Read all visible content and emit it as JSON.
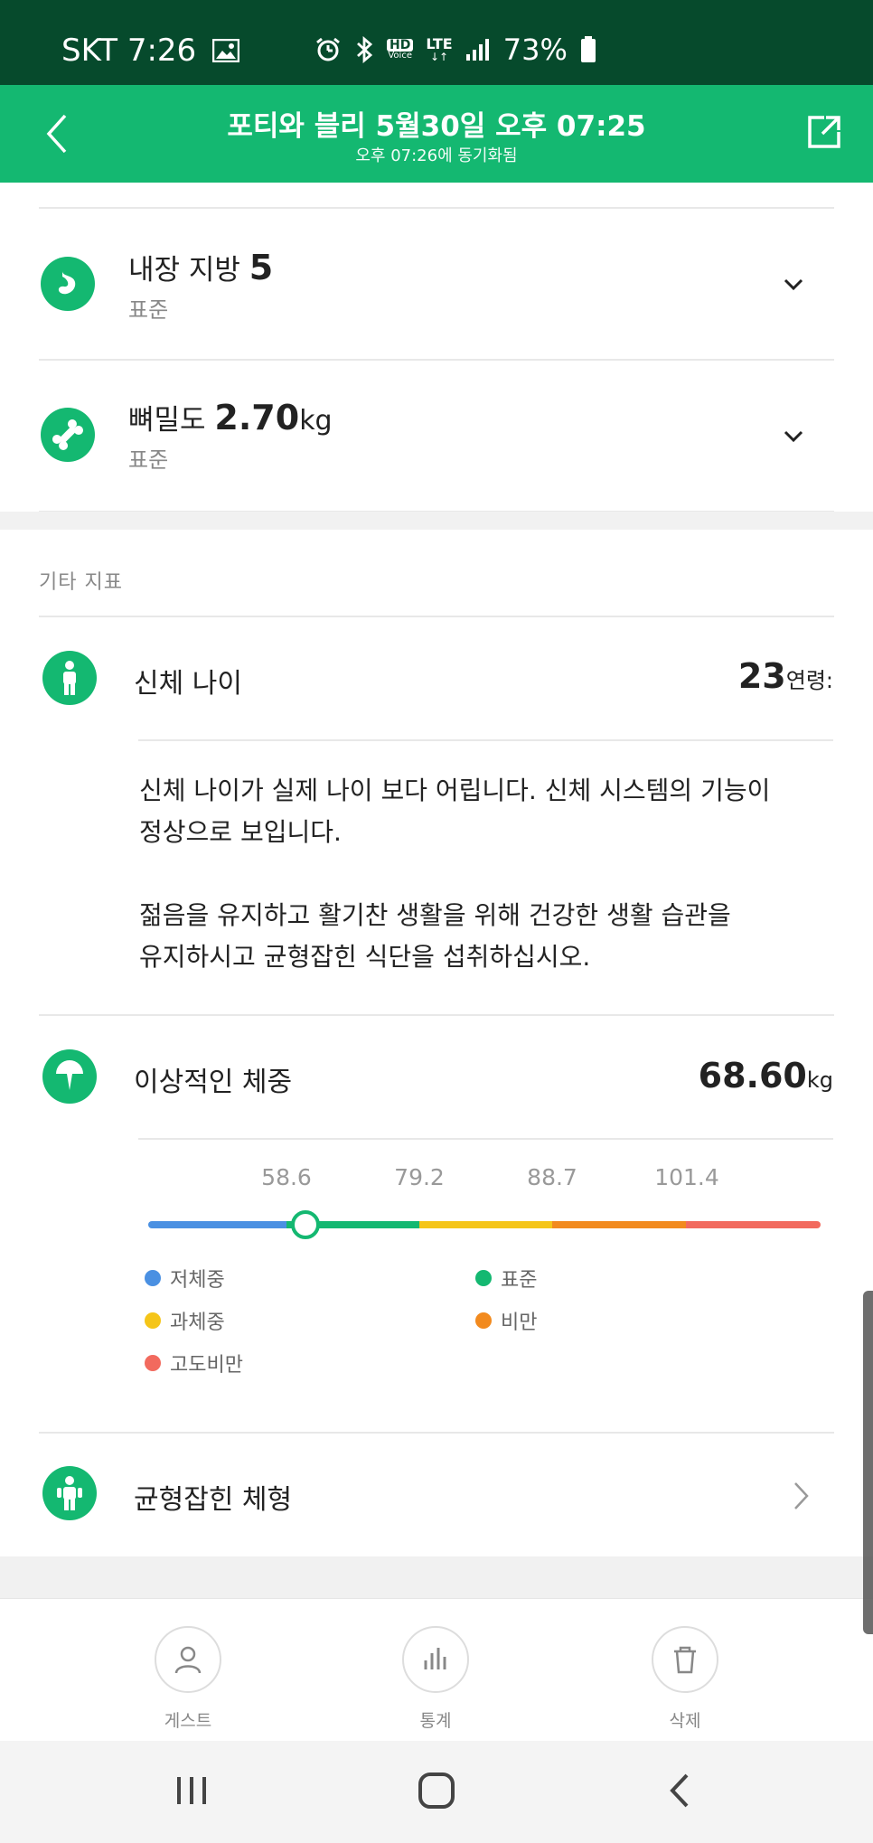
{
  "status_bar": {
    "carrier_time": "SKT 7:26",
    "network_hd": "HD",
    "network_lte": "LTE",
    "battery": "73%"
  },
  "header": {
    "title": "포티와 블리 5월30일 오후 07:25",
    "subtitle": "오후 07:26에 동기화됨"
  },
  "metrics": [
    {
      "name": "내장 지방",
      "value": "5",
      "unit": "",
      "status": "표준",
      "icon": "stomach-icon"
    },
    {
      "name": "뼈밀도",
      "value": "2.70",
      "unit": "kg",
      "status": "표준",
      "icon": "bone-icon"
    }
  ],
  "other_section": {
    "title": "기타 지표",
    "body_age": {
      "label": "신체 나이",
      "value": "23",
      "unit": "연령:",
      "paragraph1_line1": "신체 나이가 실제 나이 보다 어립니다. 신체 시스템의 기능이",
      "paragraph1_line2": "정상으로 보입니다.",
      "paragraph2_line1": "젊음을 유지하고 활기찬 생활을 위해 건강한 생활 습관을",
      "paragraph2_line2": "유지하시고 균형잡힌 식단을 섭취하십시오."
    },
    "ideal_weight": {
      "label": "이상적인 체중",
      "value": "68.60",
      "unit": "kg",
      "scale_ticks": [
        "58.6",
        "79.2",
        "88.7",
        "101.4"
      ],
      "legend": [
        {
          "label": "저체중",
          "color": "#4a90e2"
        },
        {
          "label": "표준",
          "color": "#14b871"
        },
        {
          "label": "과체중",
          "color": "#f5c518"
        },
        {
          "label": "비만",
          "color": "#f28a1e"
        },
        {
          "label": "고도비만",
          "color": "#f26a5e"
        }
      ]
    },
    "body_type": {
      "label": "균형잡힌 체형"
    }
  },
  "bottom_actions": [
    {
      "label": "게스트",
      "icon": "person-icon"
    },
    {
      "label": "통계",
      "icon": "stats-icon"
    },
    {
      "label": "삭제",
      "icon": "trash-icon"
    }
  ]
}
